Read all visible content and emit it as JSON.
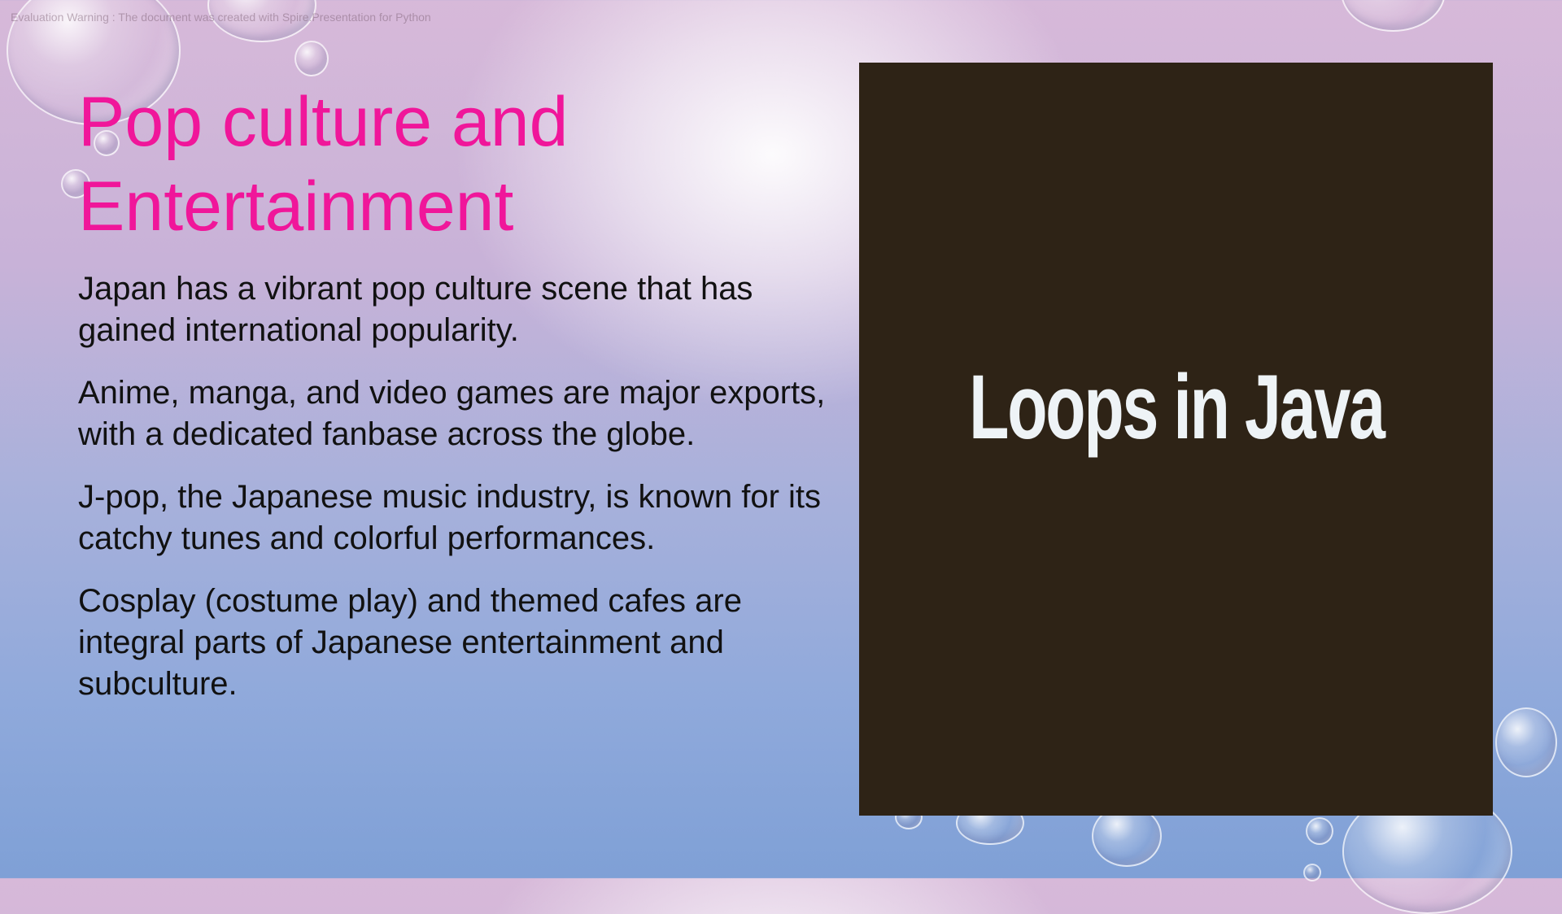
{
  "watermark": "Evaluation Warning : The document was created with Spire.Presentation for Python",
  "title": {
    "line1": "Pop culture and",
    "line2": "Entertainment"
  },
  "paragraphs": [
    "Japan has a vibrant pop culture scene that has gained international popularity.",
    "Anime, manga, and video games are major exports, with a dedicated fanbase across the globe.",
    "J-pop, the Japanese music industry, is known for its catchy tunes and colorful performances.",
    "Cosplay (costume play) and themed cafes are integral parts of Japanese entertainment and subculture."
  ],
  "image": {
    "text": "Loops in Java",
    "background": "#2e2316"
  },
  "colors": {
    "title": "#f0169a",
    "body": "#111111"
  }
}
